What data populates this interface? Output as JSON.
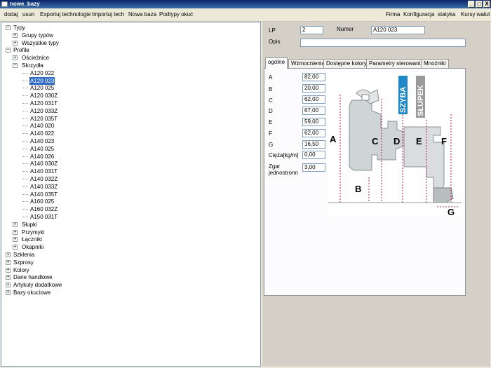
{
  "window": {
    "title": "nowe_bazy",
    "min": "_",
    "max": "□",
    "close": "X"
  },
  "menu": {
    "left": [
      "dodaj",
      "usun",
      "Exportuj technologie",
      "Importuj tech",
      "Nowa baza",
      "Podtypy okuć"
    ],
    "right": [
      "Firma",
      "Konfiguracja",
      "statyka",
      "Kursy walut"
    ]
  },
  "tree": [
    {
      "text": "Typy",
      "level": 0,
      "exp": "-"
    },
    {
      "text": "Grupy typów",
      "level": 1,
      "exp": "+"
    },
    {
      "text": "Wszystkie typy",
      "level": 1,
      "exp": "+"
    },
    {
      "text": "Profile",
      "level": 0,
      "exp": "-"
    },
    {
      "text": "Ościeżnice",
      "level": 1,
      "exp": "+"
    },
    {
      "text": "Skrzydła",
      "level": 1,
      "exp": "-"
    },
    {
      "text": "A120 022",
      "level": 2
    },
    {
      "text": "A120 023",
      "level": 2,
      "selected": true
    },
    {
      "text": "A120 025",
      "level": 2
    },
    {
      "text": "A120 030Z",
      "level": 2
    },
    {
      "text": "A120 031T",
      "level": 2
    },
    {
      "text": "A120 033Z",
      "level": 2
    },
    {
      "text": "A120 035T",
      "level": 2
    },
    {
      "text": "A140 020",
      "level": 2
    },
    {
      "text": "A140 022",
      "level": 2
    },
    {
      "text": "A140 023",
      "level": 2
    },
    {
      "text": "A140 025",
      "level": 2
    },
    {
      "text": "A140 026",
      "level": 2
    },
    {
      "text": "A140 030Z",
      "level": 2
    },
    {
      "text": "A140 031T",
      "level": 2
    },
    {
      "text": "A140 032Z",
      "level": 2
    },
    {
      "text": "A140 033Z",
      "level": 2
    },
    {
      "text": "A140 035T",
      "level": 2
    },
    {
      "text": "A160 025",
      "level": 2
    },
    {
      "text": "A160 032Z",
      "level": 2
    },
    {
      "text": "A150 031T",
      "level": 2
    },
    {
      "text": "Słupki",
      "level": 1,
      "exp": "+"
    },
    {
      "text": "Przymyki",
      "level": 1,
      "exp": "+"
    },
    {
      "text": "Łączniki",
      "level": 1,
      "exp": "+"
    },
    {
      "text": "Okapniki",
      "level": 1,
      "exp": "+"
    },
    {
      "text": "Szklenia",
      "level": 0,
      "exp": "+"
    },
    {
      "text": "Szprosy",
      "level": 0,
      "exp": "+"
    },
    {
      "text": "Kolory",
      "level": 0,
      "exp": "+"
    },
    {
      "text": "Dane handlowe",
      "level": 0,
      "exp": "+"
    },
    {
      "text": "Artykuły dodatkowe",
      "level": 0,
      "exp": "+"
    },
    {
      "text": "Bazy okuciowe",
      "level": 0,
      "exp": "+"
    }
  ],
  "form": {
    "lp_label": "LP",
    "lp_value": "2",
    "numer_label": "Numer",
    "numer_value": "A120 023",
    "opis_label": "Opis",
    "opis_value": ""
  },
  "tabs": [
    "ogólne",
    "Wzmocnienia",
    "Dostępne kolory",
    "Parametry sterowania",
    "Mnożniki"
  ],
  "dimensions": [
    {
      "label": "A",
      "value": "82,00"
    },
    {
      "label": "B",
      "value": "20,00"
    },
    {
      "label": "C",
      "value": "62,00"
    },
    {
      "label": "D",
      "value": "67,00"
    },
    {
      "label": "E",
      "value": "59,00"
    },
    {
      "label": "F",
      "value": "62,00"
    },
    {
      "label": "G",
      "value": "16,50"
    },
    {
      "label": "Cięża[kg/m]",
      "value": "0,00"
    },
    {
      "label": "Zgar jednostronn",
      "value": "3,00"
    }
  ],
  "drawing": {
    "letters": [
      "A",
      "B",
      "C",
      "D",
      "E",
      "F",
      "G"
    ],
    "szyba": "SZYBA",
    "slupek": "SŁUPEK",
    "colors": {
      "dim_line": "#b0203a",
      "szyba_bg": "#1e88c8",
      "slupek_bg": "#9a9a9a",
      "profile": "#cfd4d6"
    }
  }
}
